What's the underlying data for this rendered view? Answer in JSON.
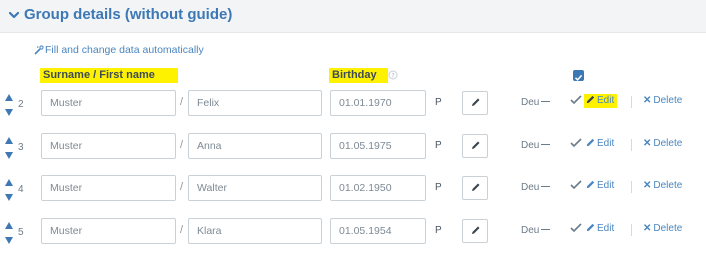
{
  "section": {
    "title": "Group details (without guide)",
    "autofill_label": "Fill and change data automatically"
  },
  "headers": {
    "surname_firstname": "Surname / First name",
    "birthday": "Birthday"
  },
  "rows": [
    {
      "num": "2",
      "surname": "Muster",
      "firstname": "Felix",
      "birthday": "01.01.1970",
      "p": "P",
      "lang": "Deu",
      "edit": "Edit",
      "delete": "Delete"
    },
    {
      "num": "3",
      "surname": "Muster",
      "firstname": "Anna",
      "birthday": "01.05.1975",
      "p": "P",
      "lang": "Deu",
      "edit": "Edit",
      "delete": "Delete"
    },
    {
      "num": "4",
      "surname": "Muster",
      "firstname": "Walter",
      "birthday": "01.02.1950",
      "p": "P",
      "lang": "Deu",
      "edit": "Edit",
      "delete": "Delete"
    },
    {
      "num": "5",
      "surname": "Muster",
      "firstname": "Klara",
      "birthday": "01.05.1954",
      "p": "P",
      "lang": "Deu",
      "edit": "Edit",
      "delete": "Delete"
    }
  ],
  "icons": {
    "collapse": "chevron-down-icon",
    "autofill": "wand-icon",
    "help": "help-icon",
    "sort": "sort-arrows-icon",
    "pencil": "pencil-icon",
    "check": "check-icon",
    "delete": "x-icon"
  },
  "colors": {
    "accent": "#3d78b5",
    "link": "#4a86c0",
    "highlight": "#fff200",
    "header_bg": "#f2f4f6"
  }
}
